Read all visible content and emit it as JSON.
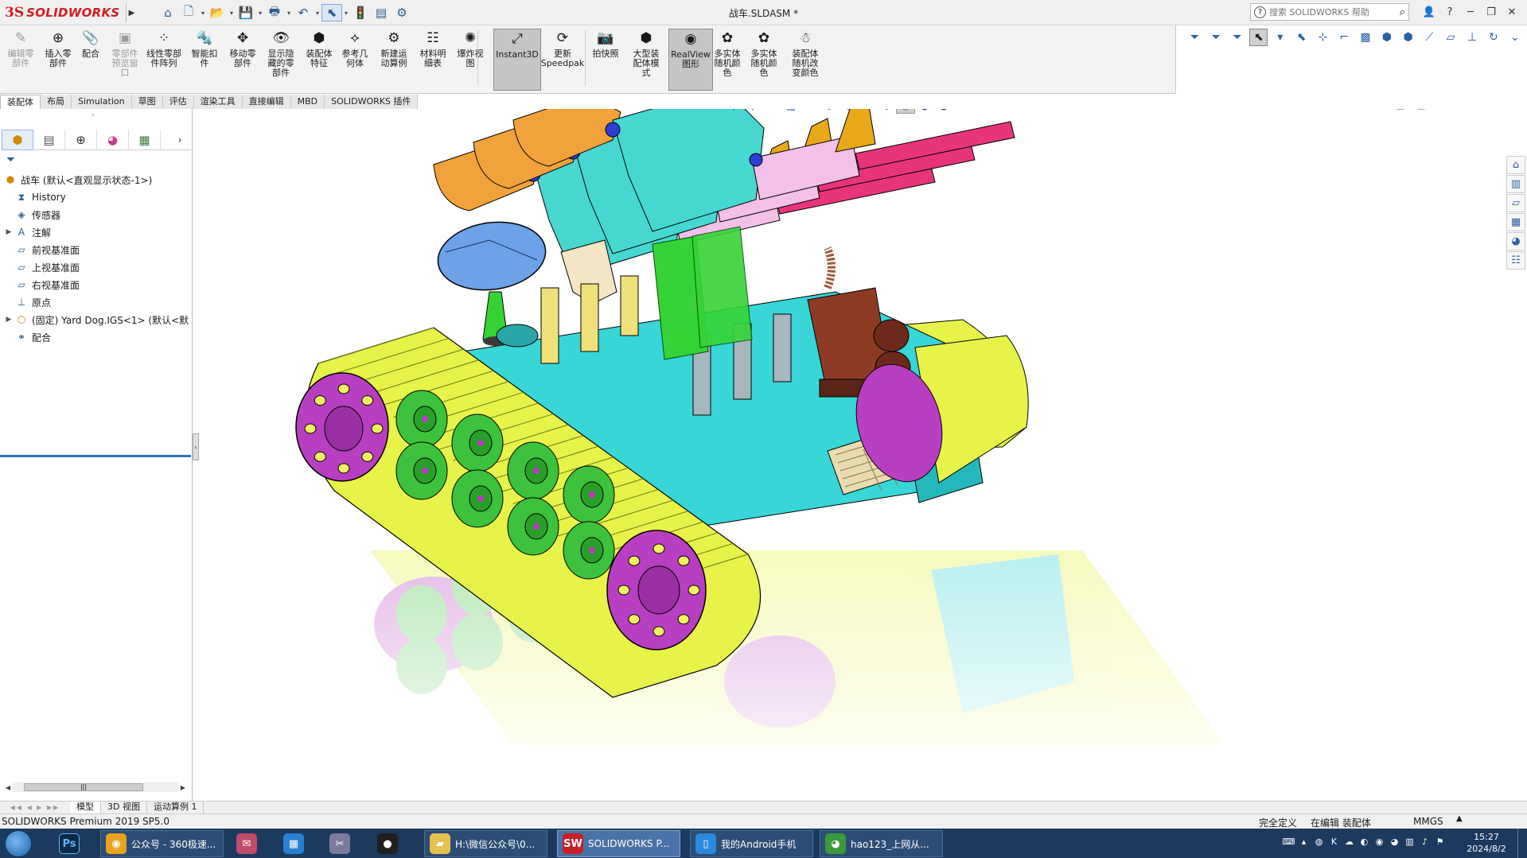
{
  "app": {
    "ds_mark": "3S",
    "brand": "SOLIDWORKS",
    "title": "战车.SLDASM *",
    "search_placeholder": "搜索 SOLIDWORKS 帮助",
    "help_glyph": "?",
    "window_controls": [
      "─",
      "❐",
      "✕"
    ]
  },
  "quick_access": [
    {
      "name": "home-icon",
      "glyph": "⌂"
    },
    {
      "name": "new-document-icon",
      "glyph": "🗋"
    },
    {
      "name": "open-icon",
      "glyph": "📂"
    },
    {
      "name": "save-icon",
      "glyph": "💾"
    },
    {
      "name": "print-icon",
      "glyph": "🖶"
    },
    {
      "name": "undo-icon",
      "glyph": "↶"
    },
    {
      "name": "select-icon",
      "glyph": "⬉"
    },
    {
      "name": "traffic-light-icon",
      "glyph": "🚦"
    },
    {
      "name": "file-properties-icon",
      "glyph": "▤"
    },
    {
      "name": "options-gear-icon",
      "glyph": "⚙"
    }
  ],
  "commands": [
    {
      "label": "编辑零\n部件",
      "icon": "edit-component-icon",
      "glyph": "✎",
      "disabled": true
    },
    {
      "label": "插入零\n部件",
      "icon": "insert-components-icon",
      "glyph": "⊕"
    },
    {
      "label": "配合",
      "icon": "mate-icon",
      "glyph": "📎"
    },
    {
      "label": "零部件\n预览窗\n口",
      "icon": "component-preview-icon",
      "glyph": "▣",
      "disabled": true
    },
    {
      "label": "线性零部\n件阵列",
      "icon": "linear-pattern-icon",
      "glyph": "⁘"
    },
    {
      "label": "智能扣\n件",
      "icon": "smart-fasteners-icon",
      "glyph": "🔩"
    },
    {
      "label": "移动零\n部件",
      "icon": "move-component-icon",
      "glyph": "✥"
    },
    {
      "label": "显示隐\n藏的零\n部件",
      "icon": "show-hidden-icon",
      "glyph": "👁"
    },
    {
      "label": "装配体\n特征",
      "icon": "assembly-features-icon",
      "glyph": "⬢"
    },
    {
      "label": "参考几\n何体",
      "icon": "reference-geometry-icon",
      "glyph": "⟡"
    },
    {
      "label": "新建运\n动算例",
      "icon": "new-motion-study-icon",
      "glyph": "⚙"
    },
    {
      "label": "材料明\n细表",
      "icon": "bom-icon",
      "glyph": "☷"
    },
    {
      "label": "爆炸视\n图",
      "icon": "exploded-view-icon",
      "glyph": "✺"
    },
    {
      "label": "Instant3D",
      "icon": "instant3d-icon",
      "glyph": "⤢",
      "active": true
    },
    {
      "label": "更新\nSpeedpak",
      "icon": "speedpak-icon",
      "glyph": "⟳"
    },
    {
      "label": "拍快照",
      "icon": "snapshot-icon",
      "glyph": "📷"
    },
    {
      "label": "大型装\n配体模\n式",
      "icon": "large-assembly-icon",
      "glyph": "⬢"
    },
    {
      "label": "RealView\n图形",
      "icon": "realview-icon",
      "glyph": "◉",
      "active": true
    },
    {
      "label": "多实体\n随机颜\n色",
      "icon": "random-color-icon",
      "glyph": "✿"
    },
    {
      "label": "多实体\n随机颜\n色",
      "icon": "random-color-icon",
      "glyph": "✿"
    },
    {
      "label": "装配体\n随机改\n变颜色",
      "icon": "assembly-random-color-icon",
      "glyph": "☃"
    }
  ],
  "tabs": [
    "装配体",
    "布局",
    "Simulation",
    "草图",
    "评估",
    "渲染工具",
    "直接编辑",
    "MBD",
    "SOLIDWORKS 插件"
  ],
  "tree": {
    "root": "战车  (默认<直观显示状态-1>)",
    "items": [
      {
        "label": "History",
        "icon": "history-icon",
        "glyph": "⧗"
      },
      {
        "label": "传感器",
        "icon": "sensor-icon",
        "glyph": "◈"
      },
      {
        "label": "注解",
        "icon": "annotation-icon",
        "glyph": "A",
        "expandable": true
      },
      {
        "label": "前视基准面",
        "icon": "plane-icon",
        "glyph": "▱"
      },
      {
        "label": "上视基准面",
        "icon": "plane-icon",
        "glyph": "▱"
      },
      {
        "label": "右视基准面",
        "icon": "plane-icon",
        "glyph": "▱"
      },
      {
        "label": "原点",
        "icon": "origin-icon",
        "glyph": "⊥"
      },
      {
        "label": "(固定) Yard Dog.IGS<1> (默认<默",
        "icon": "part-icon",
        "glyph": "⬡",
        "expandable": true
      },
      {
        "label": "配合",
        "icon": "mates-folder-icon",
        "glyph": "⚭"
      }
    ]
  },
  "bottom_tabs": [
    "模型",
    "3D 视图",
    "运动算例 1"
  ],
  "status": {
    "product": "SOLIDWORKS Premium 2019 SP5.0",
    "definition": "完全定义",
    "mode": "在编辑 装配体",
    "units": "MMGS",
    "units_arrow": "▲"
  },
  "taskbar": {
    "items": [
      {
        "label": "公众号 - 360极速...",
        "icon": "browser-360-icon",
        "color": "#e8a21b",
        "glyph": "◉"
      },
      {
        "label": "",
        "icon": "mail-app-icon",
        "color": "#c04b6a",
        "glyph": "✉"
      },
      {
        "label": "",
        "icon": "store-app-icon",
        "color": "#2b7fd3",
        "glyph": "▦"
      },
      {
        "label": "",
        "icon": "tool-app-icon",
        "color": "#7b7b9a",
        "glyph": "✂"
      },
      {
        "label": "",
        "icon": "record-app-icon",
        "color": "#202020",
        "glyph": "●"
      },
      {
        "label": "H:\\微信公众号\\0...",
        "icon": "folder-icon",
        "color": "#e6c04f",
        "glyph": "▰"
      },
      {
        "label": "SOLIDWORKS P...",
        "icon": "solidworks-icon",
        "color": "#c81e28",
        "glyph": "SW"
      },
      {
        "label": "我的Android手机",
        "icon": "phone-icon",
        "color": "#2b8ae0",
        "glyph": "▯"
      },
      {
        "label": "hao123_上网从...",
        "icon": "chrome-icon",
        "color": "#3a9a3a",
        "glyph": "◕"
      }
    ],
    "photoshop_label": "Ps",
    "clock_time": "15:27",
    "clock_date": "2024/8/2"
  },
  "scene_colors": {
    "track": "#e8f34a",
    "wheel_hub": "#b83fc1",
    "road_wheel": "#3cc23c",
    "hull": "#38d6d6",
    "stock": "#f2a23a",
    "receiver": "#46d8d0",
    "barrel": "#e8347a",
    "handguard": "#f2c0e8",
    "magazine": "#36d336",
    "post": "#f0e07a",
    "grey_post": "#a8b6c0",
    "engine": "#8e3b26",
    "radar": "#6ea2e8"
  }
}
